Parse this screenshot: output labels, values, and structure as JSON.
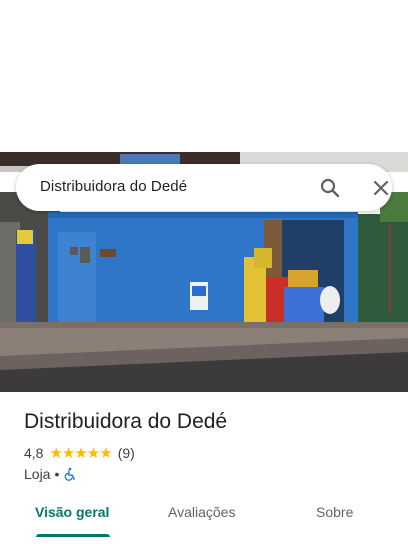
{
  "search": {
    "query": "Distribuidora do Dedé",
    "search_icon": "search-icon",
    "close_icon": "close-icon"
  },
  "hero": {
    "photo": "storefront-photo"
  },
  "place": {
    "name": "Distribuidora do Dedé",
    "rating": "4,8",
    "stars": "★★★★★",
    "review_count": "(9)",
    "category": "Loja",
    "separator": "•",
    "accessibility_icon": "wheelchair-icon"
  },
  "tabs": [
    {
      "label": "Visão geral",
      "active": true
    },
    {
      "label": "Avaliações",
      "active": false
    },
    {
      "label": "Sobre",
      "active": false
    }
  ],
  "colors": {
    "accent": "#00796b",
    "star": "#fbbc04",
    "access": "#1a73e8"
  }
}
